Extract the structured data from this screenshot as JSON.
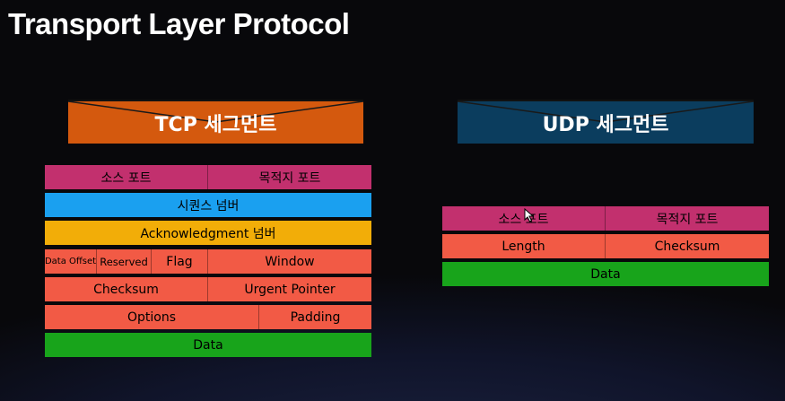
{
  "title": "Transport Layer Protocol",
  "colors": {
    "tcp_header": "#d4590e",
    "udp_header": "#0b3d5e",
    "magenta": "#c2306e",
    "blue": "#1aa0f0",
    "orange": "#f2ad08",
    "red": "#f25a45",
    "green": "#18a41b"
  },
  "tcp": {
    "header": "TCP 세그먼트",
    "rows": [
      {
        "color": "magenta",
        "cells": [
          {
            "label": "소스 포트"
          },
          {
            "label": "목적지 포트"
          }
        ]
      },
      {
        "color": "blue",
        "cells": [
          {
            "label": "시퀀스 넘버"
          }
        ]
      },
      {
        "color": "orange",
        "cells": [
          {
            "label": "Acknowledgment 넘버"
          }
        ]
      },
      {
        "color": "red",
        "cells": [
          {
            "label": "Data Offset"
          },
          {
            "label": "Reserved"
          },
          {
            "label": "Flag"
          },
          {
            "label": "Window"
          }
        ]
      },
      {
        "color": "red",
        "cells": [
          {
            "label": "Checksum"
          },
          {
            "label": "Urgent Pointer"
          }
        ]
      },
      {
        "color": "red",
        "cells": [
          {
            "label": "Options"
          },
          {
            "label": "Padding"
          }
        ]
      },
      {
        "color": "green",
        "cells": [
          {
            "label": "Data"
          }
        ]
      }
    ]
  },
  "udp": {
    "header": "UDP 세그먼트",
    "rows": [
      {
        "color": "magenta",
        "cells": [
          {
            "label": "소스 포트"
          },
          {
            "label": "목적지 포트"
          }
        ]
      },
      {
        "color": "red",
        "cells": [
          {
            "label": "Length"
          },
          {
            "label": "Checksum"
          }
        ]
      },
      {
        "color": "green",
        "cells": [
          {
            "label": "Data"
          }
        ]
      }
    ]
  }
}
